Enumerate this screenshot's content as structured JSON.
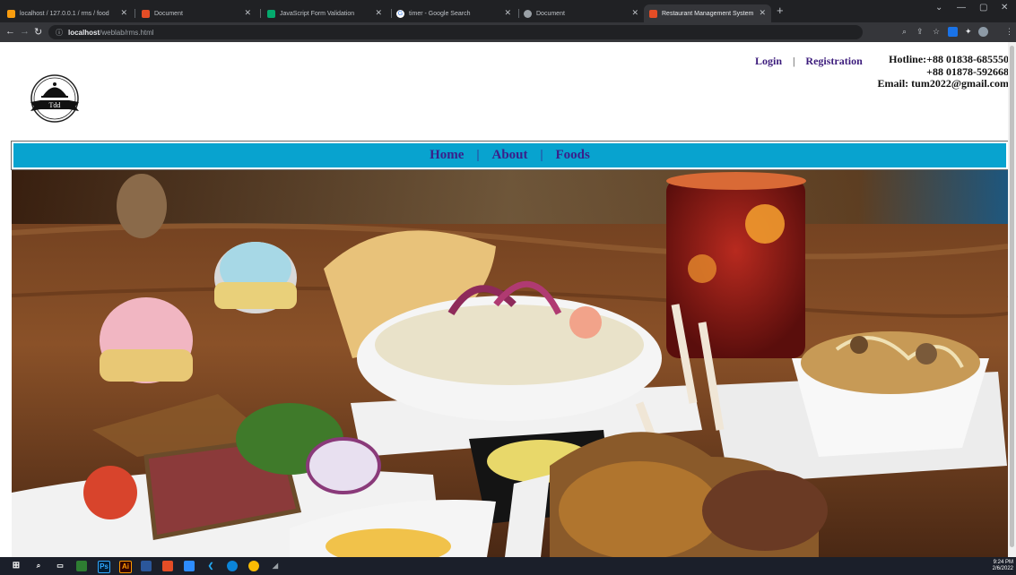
{
  "browser": {
    "tabs": [
      {
        "title": "localhost / 127.0.0.1 / rms / food",
        "icon": "phpmyadmin-icon",
        "color": "#f89c0e"
      },
      {
        "title": "Document",
        "icon": "html-document-icon",
        "color": "#e44d26"
      },
      {
        "title": "JavaScript Form Validation",
        "icon": "w3schools-icon",
        "color": "#04aa6d"
      },
      {
        "title": "timer - Google Search",
        "icon": "google-icon",
        "color": "#ffffff"
      },
      {
        "title": "Document",
        "icon": "globe-icon",
        "color": "#9aa0a6"
      },
      {
        "title": "Restaurant Management System",
        "icon": "html-document-icon",
        "color": "#e44d26"
      }
    ],
    "url_host": "localhost",
    "url_path": "/weblab/rms.html"
  },
  "header": {
    "login": "Login",
    "registration": "Registration",
    "separator": "|",
    "hotline_1": "Hotline:+88 01838-685550",
    "hotline_2": "+88 01878-592668",
    "email": "Email: tum2022@gmail.com",
    "logo_text": "Tdd"
  },
  "nav": {
    "items": [
      "Home",
      "About",
      "Foods"
    ],
    "separator": "|"
  },
  "taskbar": {
    "time": "9:24 PM",
    "date": "2/6/2022"
  },
  "colors": {
    "nav_bg": "#08a3cf",
    "link": "#3c1c7c"
  }
}
